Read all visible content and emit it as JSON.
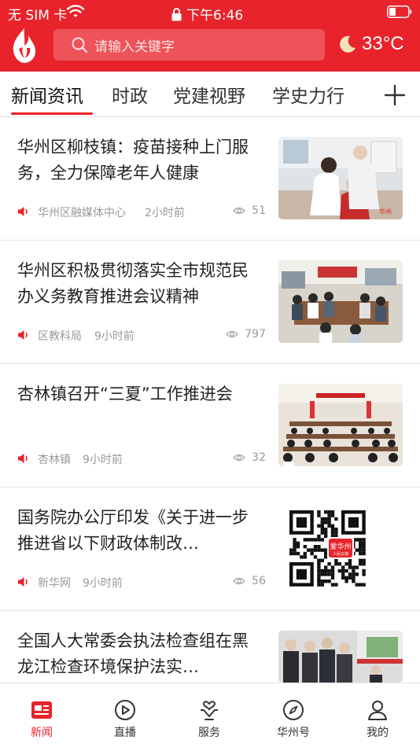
{
  "status_bar": {
    "carrier": "无 SIM 卡",
    "time": "下午6:46"
  },
  "header": {
    "search_placeholder": "请输入关键字",
    "temperature": "33°C",
    "brand_color": "#e8232b"
  },
  "tabs": [
    {
      "label": "新闻资讯",
      "active": true
    },
    {
      "label": "时政"
    },
    {
      "label": "党建视野"
    },
    {
      "label": "学史力行"
    }
  ],
  "news": [
    {
      "title": "华州区柳枝镇：疫苗接种上门服务，全力保障老年人健康",
      "source": "华州区融媒体中心",
      "time": "2小时前",
      "views": "51",
      "thumb": "vaccination-photo"
    },
    {
      "title": "华州区积极贯彻落实全市规范民办义务教育推进会议精神",
      "source": "区教科局",
      "time": "9小时前",
      "views": "797",
      "thumb": "meeting-room-photo"
    },
    {
      "title": "杏林镇召开“三夏”工作推进会",
      "source": "杏林镇",
      "time": "9小时前",
      "views": "32",
      "thumb": "conference-hall-photo"
    },
    {
      "title": "国务院办公厅印发《关于进一步推进省以下财政体制改…",
      "source": "新华网",
      "time": "9小时前",
      "views": "56",
      "thumb": "qr-code",
      "qr_badge": "爱华州",
      "qr_badge_sub": "人民云端"
    },
    {
      "title": "全国人大常委会执法检查组在黑龙江检查环境保护法实…",
      "thumb": "inspection-photo"
    }
  ],
  "bottom_nav": [
    {
      "label": "新闻",
      "icon": "news-icon",
      "active": true
    },
    {
      "label": "直播",
      "icon": "play-icon"
    },
    {
      "label": "服务",
      "icon": "service-icon"
    },
    {
      "label": "华州号",
      "icon": "compass-icon"
    },
    {
      "label": "我的",
      "icon": "user-icon"
    }
  ]
}
